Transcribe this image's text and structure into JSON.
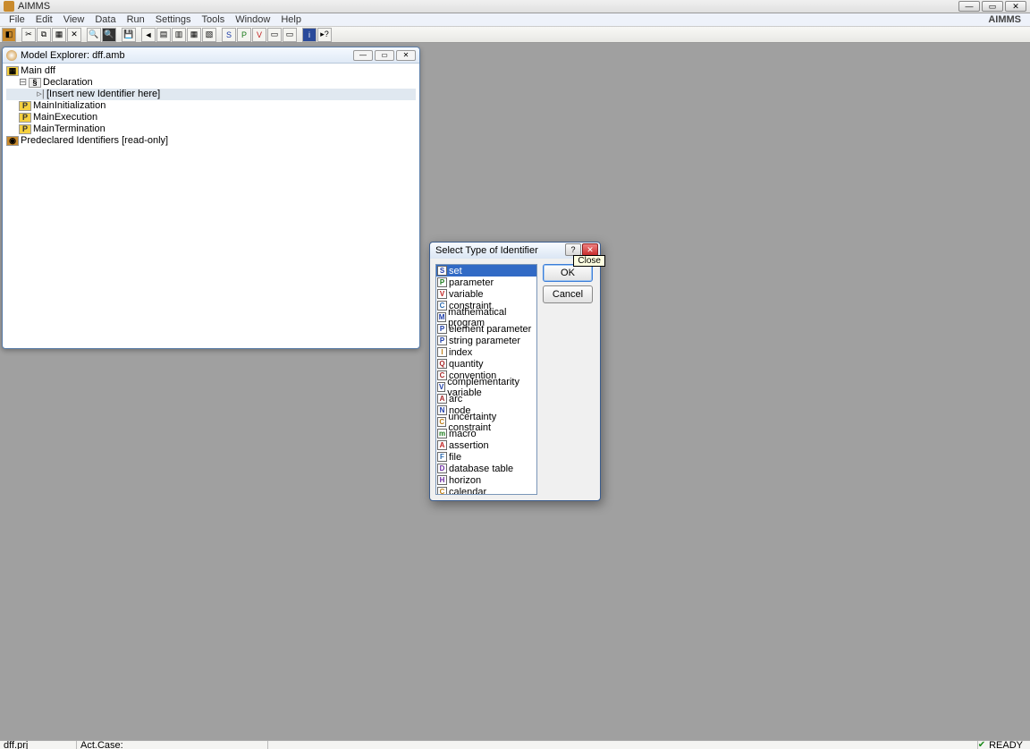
{
  "window": {
    "title": "AIMMS",
    "brand": "AIMMS"
  },
  "menu": [
    "File",
    "Edit",
    "View",
    "Data",
    "Run",
    "Settings",
    "Tools",
    "Window",
    "Help"
  ],
  "explorer": {
    "title": "Model Explorer: dff.amb",
    "tree": {
      "root": "Main dff",
      "declaration": "Declaration",
      "insert": "[Insert new Identifier here]",
      "init": "MainInitialization",
      "exec": "MainExecution",
      "term": "MainTermination",
      "predecl": "Predeclared Identifiers [read-only]"
    }
  },
  "dialog": {
    "title": "Select Type of Identifier",
    "tooltip": "Close",
    "ok": "OK",
    "cancel": "Cancel",
    "items": [
      {
        "icon": "S",
        "cls": "ic-S",
        "label": "set"
      },
      {
        "icon": "P",
        "cls": "ic-P",
        "label": "parameter"
      },
      {
        "icon": "V",
        "cls": "ic-V",
        "label": "variable"
      },
      {
        "icon": "C",
        "cls": "ic-C",
        "label": "constraint"
      },
      {
        "icon": "M",
        "cls": "ic-S",
        "label": "mathematical program"
      },
      {
        "icon": "P",
        "cls": "ic-S",
        "label": "element parameter"
      },
      {
        "icon": "P",
        "cls": "ic-S",
        "label": "string parameter"
      },
      {
        "icon": "I",
        "cls": "ic-I",
        "label": "index"
      },
      {
        "icon": "Q",
        "cls": "ic-Q",
        "label": "quantity"
      },
      {
        "icon": "C",
        "cls": "ic-Q",
        "label": "convention"
      },
      {
        "icon": "V",
        "cls": "ic-S",
        "label": "complementarity variable"
      },
      {
        "icon": "A",
        "cls": "ic-Q",
        "label": "arc"
      },
      {
        "icon": "N",
        "cls": "ic-S",
        "label": "node"
      },
      {
        "icon": "C",
        "cls": "ic-I",
        "label": "uncertainty constraint"
      },
      {
        "icon": "m",
        "cls": "ic-P",
        "label": "macro"
      },
      {
        "icon": "A",
        "cls": "ic-V",
        "label": "assertion"
      },
      {
        "icon": "F",
        "cls": "ic-F",
        "label": "file"
      },
      {
        "icon": "D",
        "cls": "ic-H",
        "label": "database table"
      },
      {
        "icon": "H",
        "cls": "ic-H",
        "label": "horizon"
      },
      {
        "icon": "C",
        "cls": "ic-I",
        "label": "calendar"
      }
    ]
  },
  "status": {
    "left1": "dff.prj",
    "left2": "Act.Case:",
    "ready": "READY"
  }
}
